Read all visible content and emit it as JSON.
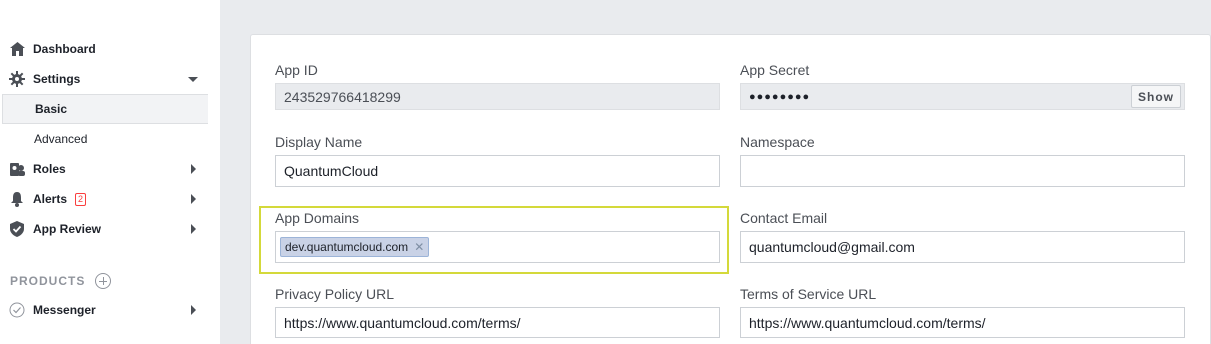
{
  "sidebar": {
    "items": [
      {
        "label": "Dashboard",
        "icon": "home-icon"
      },
      {
        "label": "Settings",
        "icon": "gear-icon"
      },
      {
        "label": "Roles",
        "icon": "roles-icon"
      },
      {
        "label": "Alerts",
        "icon": "bell-icon",
        "badge": "2"
      },
      {
        "label": "App Review",
        "icon": "shield-check-icon"
      }
    ],
    "settings_sub": [
      {
        "label": "Basic",
        "active": true
      },
      {
        "label": "Advanced",
        "active": false
      }
    ],
    "products_heading": "PRODUCTS",
    "products": [
      {
        "label": "Messenger",
        "icon": "check-circle-icon"
      }
    ]
  },
  "form": {
    "app_id": {
      "label": "App ID",
      "value": "243529766418299"
    },
    "app_secret": {
      "label": "App Secret",
      "value": "●●●●●●●●",
      "button": "Show"
    },
    "display_name": {
      "label": "Display Name",
      "value": "QuantumCloud"
    },
    "namespace": {
      "label": "Namespace",
      "value": ""
    },
    "app_domains": {
      "label": "App Domains",
      "tokens": [
        "dev.quantumcloud.com"
      ]
    },
    "contact_email": {
      "label": "Contact Email",
      "value": "quantumcloud@gmail.com"
    },
    "privacy_url": {
      "label": "Privacy Policy URL",
      "value": "https://www.quantumcloud.com/terms/"
    },
    "terms_url": {
      "label": "Terms of Service URL",
      "value": "https://www.quantumcloud.com/terms/"
    }
  },
  "colors": {
    "highlight": "#d4d93a",
    "badge": "#fa3e3e",
    "token_bg": "#c9d2e6"
  }
}
